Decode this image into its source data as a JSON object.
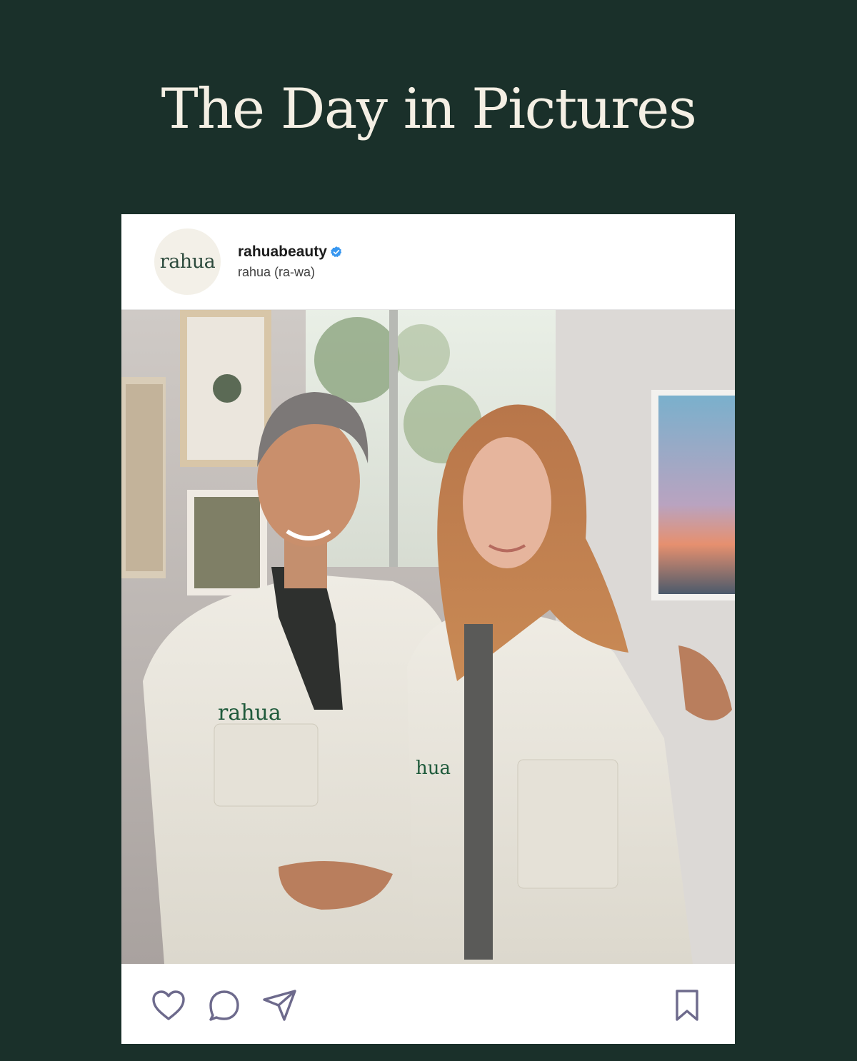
{
  "page": {
    "headline": "The Day in Pictures"
  },
  "post": {
    "avatar_text": "rahua",
    "handle": "rahuabeauty",
    "verified": true,
    "subtitle": "rahua (ra-wa)",
    "image": {
      "jacket_logo_left": "rahua",
      "jacket_logo_right": "hua"
    }
  },
  "actions": {
    "icons": [
      "heart-icon",
      "comment-icon",
      "share-icon",
      "bookmark-icon"
    ]
  },
  "colors": {
    "background": "#1a302a",
    "headline": "#f4efe4",
    "card": "#ffffff",
    "icon_stroke": "#6d6a8c",
    "verified": "#3897f0",
    "brand_green": "#2c4a3c"
  }
}
